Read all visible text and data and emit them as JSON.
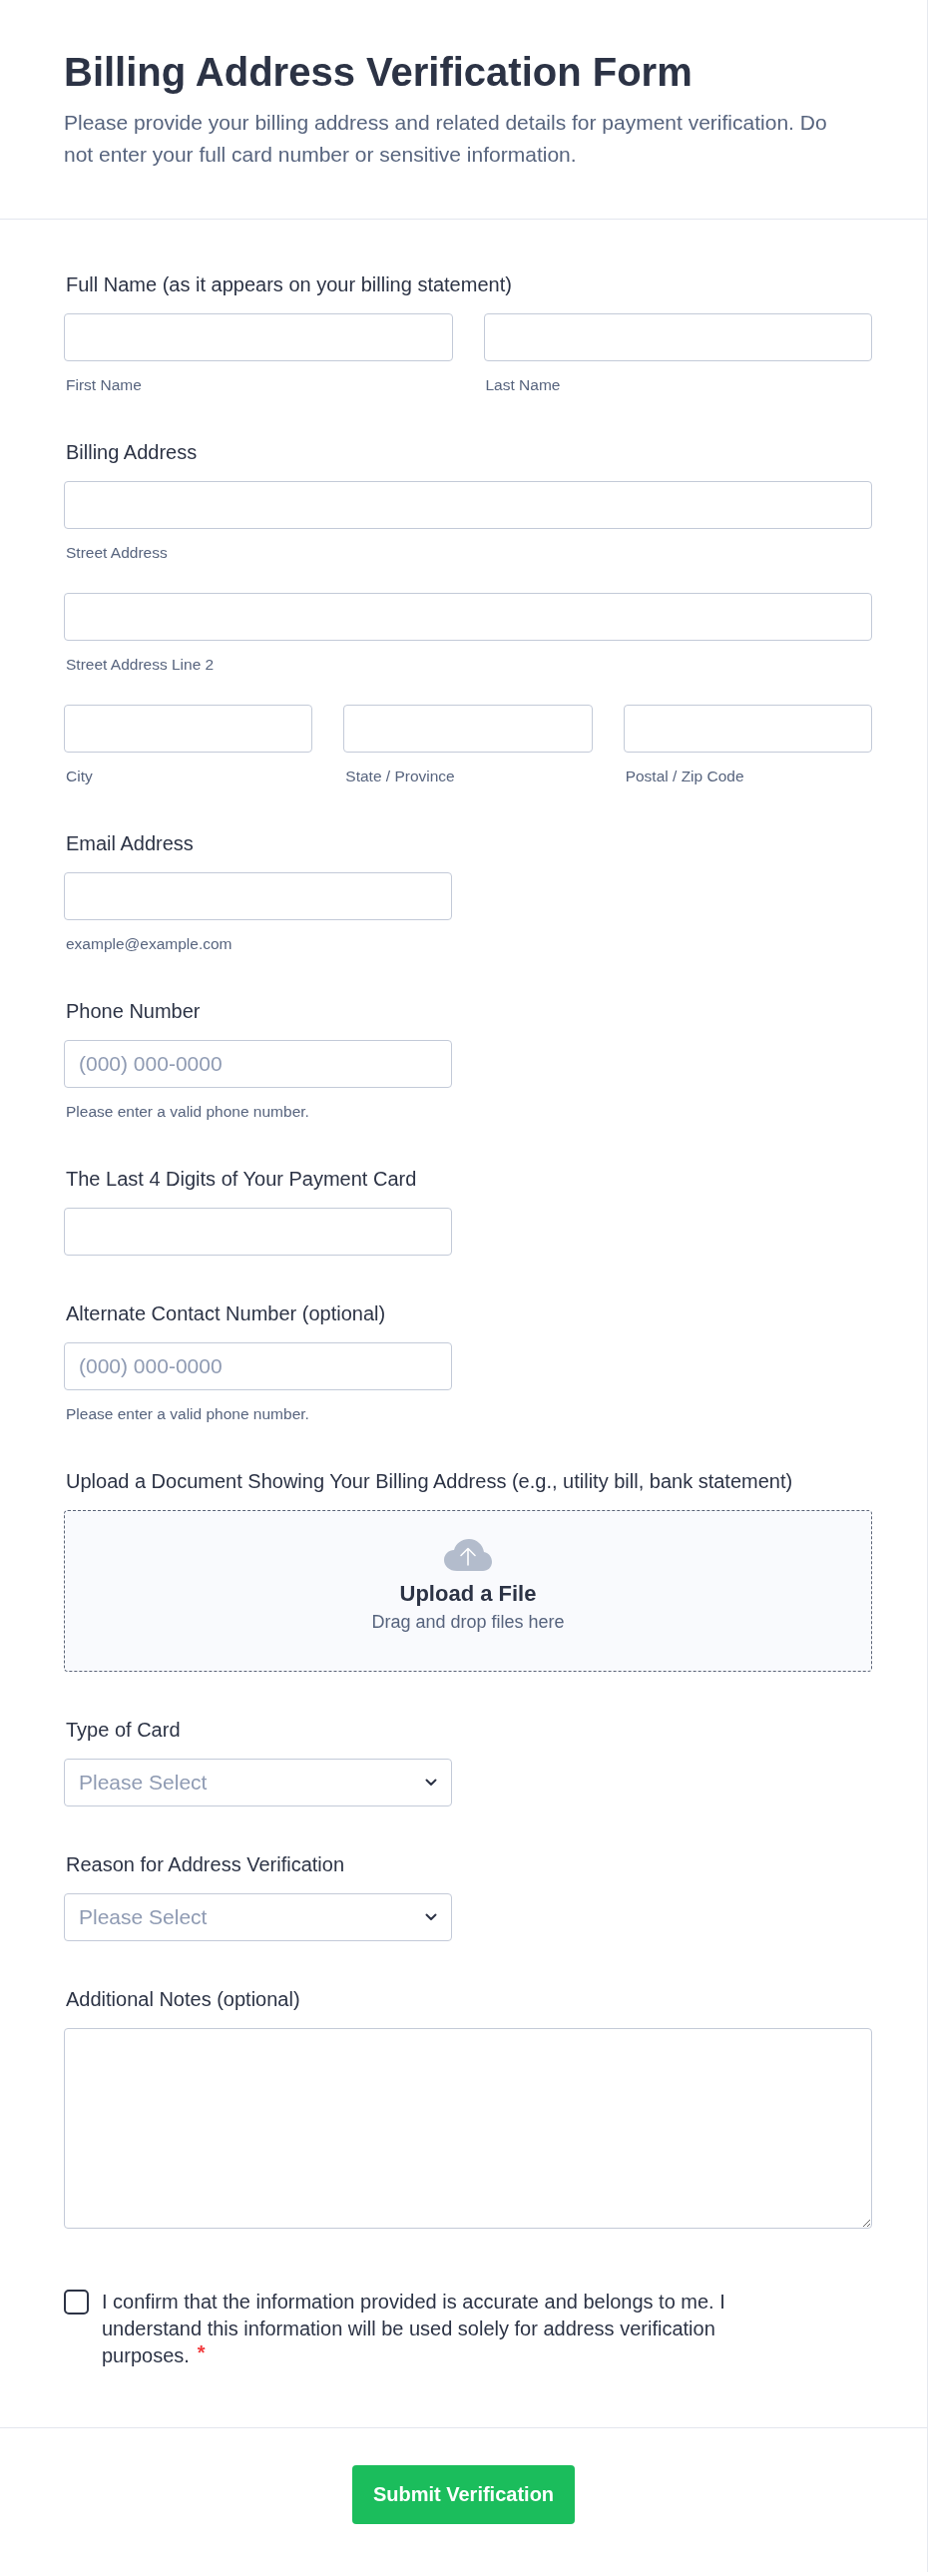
{
  "header": {
    "title": "Billing Address Verification Form",
    "description": "Please provide your billing address and related details for payment verification. Do not enter your full card number or sensitive information."
  },
  "fields": [
    {
      "kind": "group",
      "label": "Full Name (as it appears on your billing statement)",
      "rows": [
        [
          {
            "sublabel": "First Name"
          },
          {
            "sublabel": "Last Name"
          }
        ]
      ]
    },
    {
      "kind": "group",
      "label": "Billing Address",
      "rows": [
        [
          {
            "sublabel": "Street Address"
          }
        ],
        [
          {
            "sublabel": "Street Address Line 2"
          }
        ],
        [
          {
            "sublabel": "City"
          },
          {
            "sublabel": "State / Province"
          },
          {
            "sublabel": "Postal / Zip Code"
          }
        ]
      ]
    },
    {
      "kind": "text",
      "label": "Email Address",
      "sublabel": "example@example.com"
    },
    {
      "kind": "text",
      "label": "Phone Number",
      "placeholder": "(000) 000-0000",
      "sublabel": "Please enter a valid phone number."
    },
    {
      "kind": "text",
      "label": "The Last 4 Digits of Your Payment Card"
    },
    {
      "kind": "text",
      "label": "Alternate Contact Number (optional)",
      "placeholder": "(000) 000-0000",
      "sublabel": "Please enter a valid phone number."
    },
    {
      "kind": "upload",
      "label": "Upload a Document Showing Your Billing Address (e.g., utility bill, bank statement)",
      "title": "Upload a File",
      "subtitle": "Drag and drop files here"
    },
    {
      "kind": "select",
      "label": "Type of Card",
      "placeholder": "Please Select"
    },
    {
      "kind": "select",
      "label": "Reason for Address Verification",
      "placeholder": "Please Select"
    },
    {
      "kind": "textarea",
      "label": "Additional Notes (optional)"
    },
    {
      "kind": "checkbox",
      "text": "I confirm that the information provided is accurate and belongs to me. I understand this information will be used solely for address verification purposes.",
      "checked": false,
      "required_mark": "*"
    }
  ],
  "submit_button": {
    "label": "Submit Verification"
  }
}
